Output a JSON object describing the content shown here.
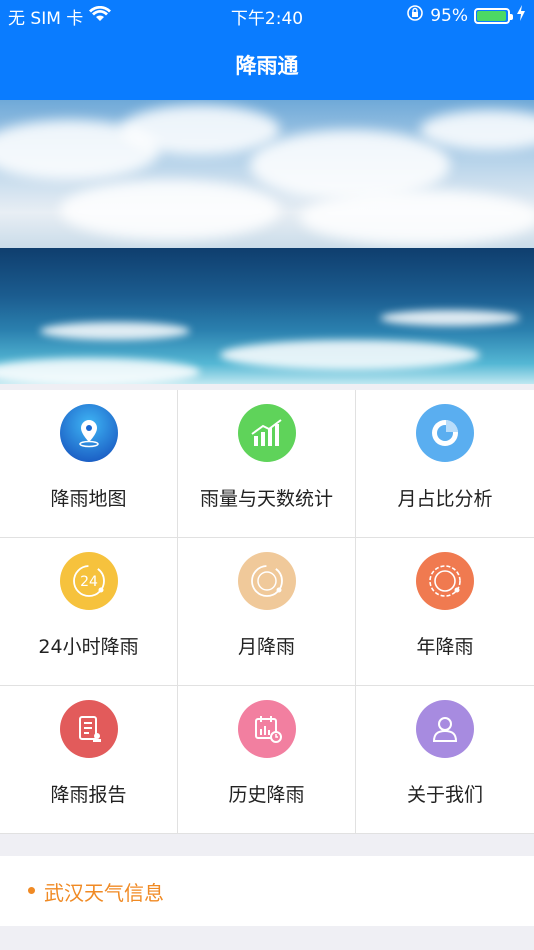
{
  "status_bar": {
    "carrier": "无 SIM 卡",
    "time": "下午2:40",
    "battery_percent": "95%",
    "battery_level": 0.95,
    "icons": [
      "wifi-icon",
      "orientation-lock-icon",
      "battery-icon",
      "charging-icon"
    ]
  },
  "header": {
    "title": "降雨通"
  },
  "colors": {
    "accent": "#0a7cff",
    "info_orange": "#f08a24"
  },
  "menu": [
    {
      "label": "降雨地图",
      "icon": "map-pin-icon",
      "color": "#1a66d0"
    },
    {
      "label": "雨量与天数统计",
      "icon": "bar-chart-icon",
      "color": "#5fd35a"
    },
    {
      "label": "月占比分析",
      "icon": "pie-chart-icon",
      "color": "#5aaef0"
    },
    {
      "label": "24小时降雨",
      "icon": "24h-clock-icon",
      "color": "#f6c23d"
    },
    {
      "label": "月降雨",
      "icon": "month-clock-icon",
      "color": "#f0c99a"
    },
    {
      "label": "年降雨",
      "icon": "year-badge-icon",
      "color": "#f07a50"
    },
    {
      "label": "降雨报告",
      "icon": "report-icon",
      "color": "#e25b5b"
    },
    {
      "label": "历史降雨",
      "icon": "history-calendar-icon",
      "color": "#f27fa0"
    },
    {
      "label": "关于我们",
      "icon": "user-profile-icon",
      "color": "#a78be0"
    }
  ],
  "info": {
    "title": "武汉天气信息"
  }
}
